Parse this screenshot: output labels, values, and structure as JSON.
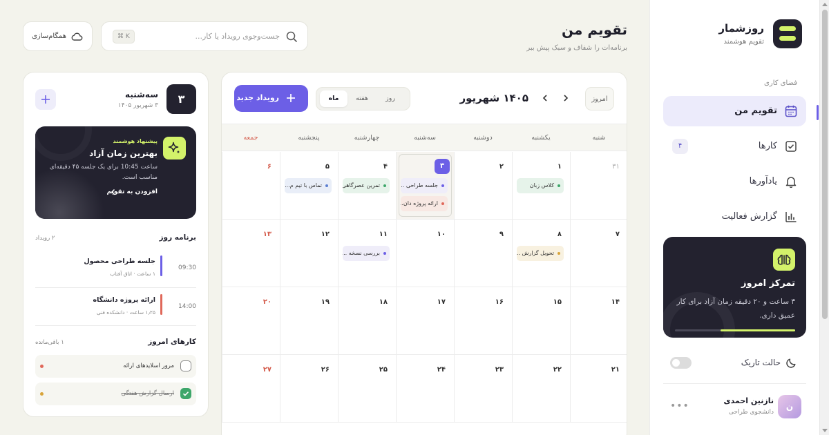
{
  "sidebar": {
    "brand_name": "روزشمار",
    "brand_sub": "تقویم هوشمند",
    "workspace_label": "فضای کاری",
    "items": [
      {
        "label": "تقویم من",
        "icon": "calendar-icon",
        "active": true
      },
      {
        "label": "کارها",
        "icon": "checkbox-icon",
        "badge": "۴"
      },
      {
        "label": "یادآورها",
        "icon": "bell-icon"
      },
      {
        "label": "گزارش فعالیت",
        "icon": "chart-icon"
      }
    ],
    "focus": {
      "title": "تمرکز امروز",
      "desc": "۳ ساعت و ۲۰ دقیقه زمان آزاد برای کار عمیق داری.",
      "progress": 0.62
    },
    "dark_mode_label": "حالت تاریک",
    "user": {
      "name": "نازنین احمدی",
      "role": "دانشجوی طراحی",
      "initial": "ن"
    },
    "more": "•••"
  },
  "header": {
    "title": "تقویم من",
    "subtitle": "برنامه‌ات را شفاف و سبک پیش ببر",
    "search_placeholder": "جست‌وجوی رویداد یا کار...",
    "search_kbd": "⌘ K",
    "sync_label": "همگام‌سازی"
  },
  "calendar": {
    "today_label": "امروز",
    "month_title": "۱۴۰۵ شهریور",
    "views": [
      "روز",
      "هفته",
      "ماه"
    ],
    "active_view": "ماه",
    "new_event_label": "رویداد جدید",
    "weekdays": [
      "شنبه",
      "یکشنبه",
      "دوشنبه",
      "سه‌شنبه",
      "چهارشنبه",
      "پنجشنبه",
      "جمعه"
    ],
    "weeks": [
      [
        {
          "n": "۳۱",
          "prev": true
        },
        {
          "n": "۱",
          "events": [
            {
              "t": "کلاس زبان",
              "c": "green"
            }
          ]
        },
        {
          "n": "۲"
        },
        {
          "n": "۳",
          "today": true,
          "events": [
            {
              "t": "جلسه طراحی ...",
              "c": "purple"
            },
            {
              "t": "ارائه پروژه دان...",
              "c": "pink"
            }
          ]
        },
        {
          "n": "۴",
          "events": [
            {
              "t": "تمرین عصرگاهی",
              "c": "green"
            }
          ]
        },
        {
          "n": "۵",
          "events": [
            {
              "t": "تماس با تیم م...",
              "c": "blue"
            }
          ]
        },
        {
          "n": "۶",
          "fri": true
        }
      ],
      [
        {
          "n": "۷"
        },
        {
          "n": "۸",
          "events": [
            {
              "t": "تحویل گزارش ...",
              "c": "yellow"
            }
          ]
        },
        {
          "n": "۹"
        },
        {
          "n": "۱۰"
        },
        {
          "n": "۱۱",
          "events": [
            {
              "t": "بررسی نسخه ...",
              "c": "purple"
            }
          ]
        },
        {
          "n": "۱۲"
        },
        {
          "n": "۱۳",
          "fri": true
        }
      ],
      [
        {
          "n": "۱۴"
        },
        {
          "n": "۱۵"
        },
        {
          "n": "۱۶"
        },
        {
          "n": "۱۷"
        },
        {
          "n": "۱۸"
        },
        {
          "n": "۱۹"
        },
        {
          "n": "۲۰",
          "fri": true
        }
      ],
      [
        {
          "n": "۲۱"
        },
        {
          "n": "۲۲"
        },
        {
          "n": "۲۳"
        },
        {
          "n": "۲۴"
        },
        {
          "n": "۲۵"
        },
        {
          "n": "۲۶"
        },
        {
          "n": "۲۷",
          "fri": true
        }
      ]
    ]
  },
  "day_panel": {
    "date_num": "۳",
    "day_name": "سه‌شنبه",
    "day_date": "۳ شهریور ۱۴۰۵",
    "smart": {
      "tag": "پیشنهاد هوشمند",
      "title": "بهترین زمان آزاد",
      "desc": "ساعت 10:45 برای یک جلسه ۴۵ دقیقه‌ای مناسب است.",
      "link": "افزودن به تقویم"
    },
    "agenda_title": "برنامه روز",
    "agenda_count": "۲ رویداد",
    "agenda": [
      {
        "time": "09:30",
        "title": "جلسه طراحی محصول",
        "sub": "۱ ساعت · اتاق آفتاب",
        "color": "#6c5fe6"
      },
      {
        "time": "14:00",
        "title": "ارائه پروژه دانشگاه",
        "sub": "۱٫۲۵ ساعت · دانشکده فنی",
        "color": "#e0685a"
      }
    ],
    "tasks_title": "کارهای امروز",
    "tasks_count": "۱ باقی‌مانده",
    "tasks": [
      {
        "label": "مرور اسلایدهای ارائه",
        "done": false,
        "dot": "#e0685a"
      },
      {
        "label": "ارسال گزارش هفتگی",
        "done": true,
        "dot": "#d8a43a"
      }
    ]
  }
}
